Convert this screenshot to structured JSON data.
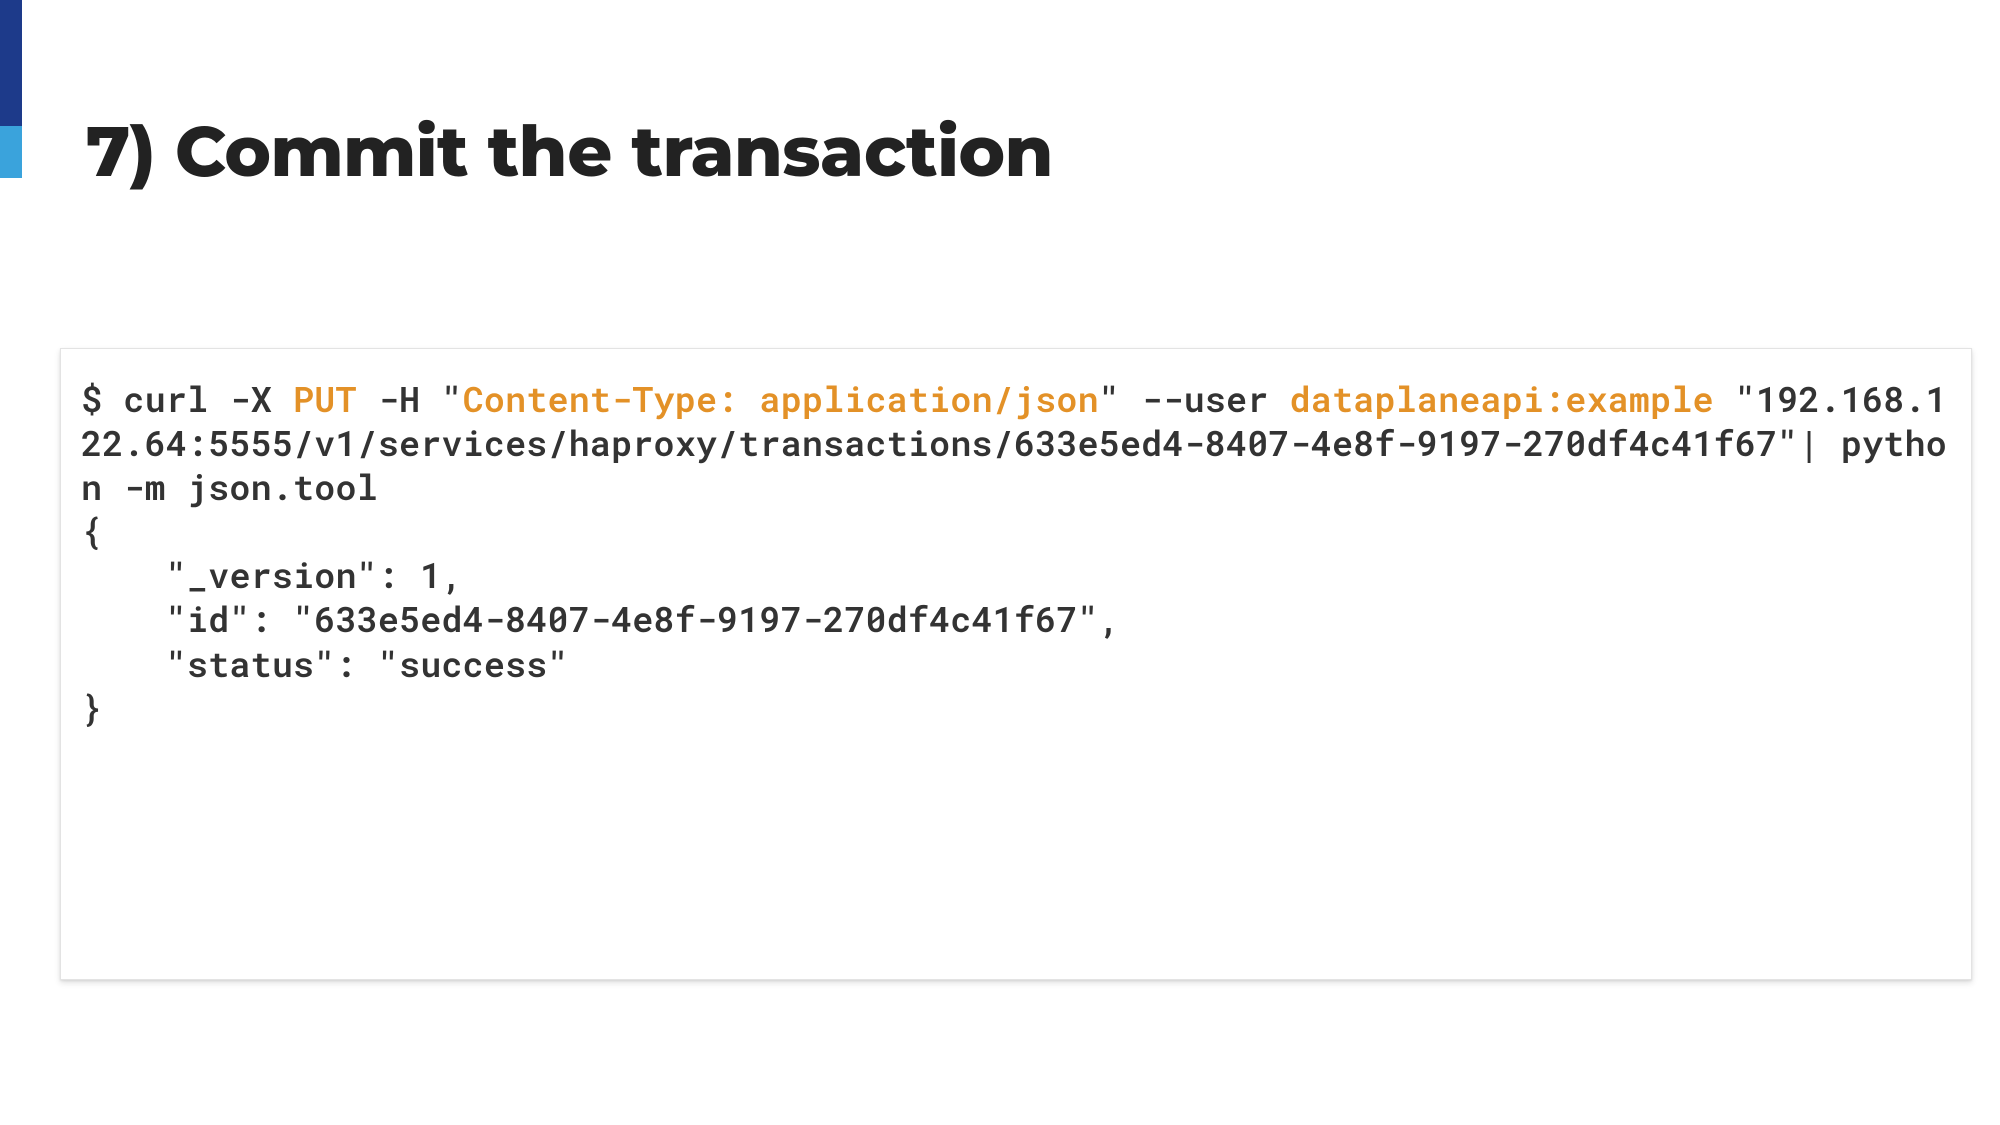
{
  "title": "7) Commit the transaction",
  "code": {
    "p1": "$ curl -X ",
    "hl1": "PUT",
    "p2": " -H \"",
    "hl2": "Content-Type: application/json",
    "p3": "\" --user ",
    "hl3": "dataplaneapi:example",
    "p4": " \"192.168.122.64:5555/v1/services/haproxy/transactions/633e5ed4-8407-4e8f-9197-270df4c41f67\"| python -m json.tool",
    "out": "{\n    \"_version\": 1,\n    \"id\": \"633e5ed4-8407-4e8f-9197-270df4c41f67\",\n    \"status\": \"success\"\n}"
  }
}
